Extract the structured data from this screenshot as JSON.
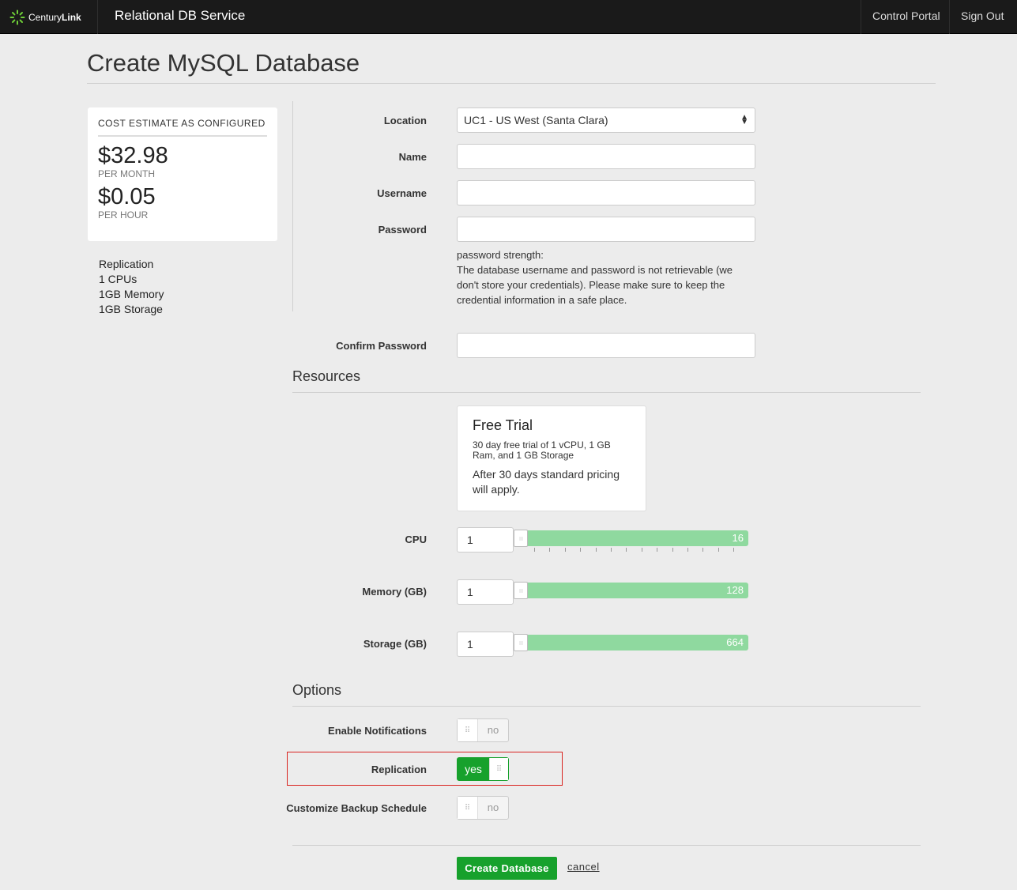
{
  "header": {
    "logo_name": "Century",
    "logo_bold": "Link",
    "service_title": "Relational DB Service",
    "nav": [
      "Control Portal",
      "Sign Out"
    ]
  },
  "page": {
    "title": "Create MySQL Database"
  },
  "cost": {
    "heading": "COST ESTIMATE AS CONFIGURED",
    "monthly": "$32.98",
    "monthly_unit": "PER MONTH",
    "hourly": "$0.05",
    "hourly_unit": "PER HOUR"
  },
  "summary": [
    "Replication",
    "1 CPUs",
    "1GB Memory",
    "1GB Storage"
  ],
  "form": {
    "location_label": "Location",
    "location_value": "UC1 - US West (Santa Clara)",
    "name_label": "Name",
    "name_value": "",
    "username_label": "Username",
    "username_value": "",
    "password_label": "Password",
    "password_value": "",
    "password_strength": "password strength:",
    "password_note": "The database username and password is not retrievable (we don't store your credentials). Please make sure to keep the credential information in a safe place.",
    "confirm_label": "Confirm Password",
    "confirm_value": ""
  },
  "resources": {
    "title": "Resources",
    "trial_title": "Free Trial",
    "trial_desc": "30 day free trial of 1 vCPU, 1 GB Ram, and 1 GB Storage",
    "trial_note": "After 30 days standard pricing will apply.",
    "cpu": {
      "label": "CPU",
      "value": "1",
      "max": "16"
    },
    "memory": {
      "label": "Memory (GB)",
      "value": "1",
      "max": "128"
    },
    "storage": {
      "label": "Storage (GB)",
      "value": "1",
      "max": "664"
    }
  },
  "options": {
    "title": "Options",
    "notifications": {
      "label": "Enable Notifications",
      "state": "no"
    },
    "replication": {
      "label": "Replication",
      "state": "yes"
    },
    "backup": {
      "label": "Customize Backup Schedule",
      "state": "no"
    }
  },
  "actions": {
    "create": "Create Database",
    "cancel": "cancel"
  },
  "colors": {
    "accent": "#17a12c",
    "slider": "#8fd99f",
    "topbar": "#1a1a1a",
    "highlight": "#d9231f"
  }
}
